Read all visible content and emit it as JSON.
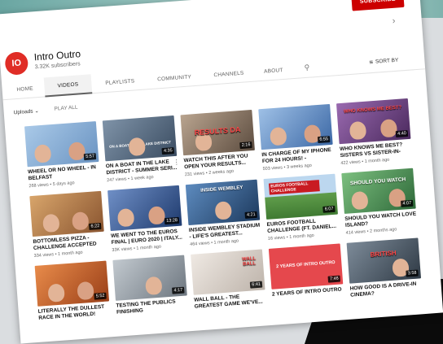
{
  "subscribe_label": "SUBSCRIBE",
  "channel": {
    "avatar_text": "IO",
    "name": "Intro Outro",
    "subscribers": "3.32K subscribers"
  },
  "tabs": [
    {
      "label": "HOME"
    },
    {
      "label": "VIDEOS"
    },
    {
      "label": "PLAYLISTS"
    },
    {
      "label": "COMMUNITY"
    },
    {
      "label": "CHANNELS"
    },
    {
      "label": "ABOUT"
    }
  ],
  "sort_by_label": "SORT BY",
  "filter": {
    "uploads_label": "Uploads",
    "play_all_label": "PLAY ALL"
  },
  "videos": [
    {
      "title": "WHEEL OR NO WHEEL - IN BELFAST",
      "meta": "268 views • 5 days ago",
      "duration": "5:57",
      "thumb_text": "",
      "thumb_color": "#8fb4d9"
    },
    {
      "title": "ON A BOAT IN THE LAKE DISTRICT - SUMMER SERI...",
      "meta": "247 views • 1 week ago",
      "duration": "4:35",
      "thumb_text": "ON A BOAT IN THE LAKE DISTRICT",
      "thumb_color": "#5a6f86"
    },
    {
      "title": "WATCH THIS AFTER YOU OPEN YOUR RESULTS...",
      "meta": "231 views • 2 weeks ago",
      "duration": "2:16",
      "thumb_text": "RESULTS DA",
      "thumb_color": "#7c6a5c"
    },
    {
      "title": "IN CHARGE OF MY IPHONE FOR 24 HOURS! - SUMMER...",
      "meta": "503 views • 3 weeks ago",
      "duration": "6:55",
      "thumb_text": "",
      "thumb_color": "#5f86b5"
    },
    {
      "title": "WHO KNOWS ME BEST? SISTERS vs SISTER-IN-LAW",
      "meta": "422 views • 1 month ago",
      "duration": "4:40",
      "thumb_text": "WHO KNOWS ME BEST?",
      "thumb_color": "#7b4b8e"
    },
    {
      "title": "BOTTOMLESS PIZZA - CHALLENGE ACCEPTED",
      "meta": "334 views • 1 month ago",
      "duration": "6:22",
      "thumb_text": "",
      "thumb_color": "#b9824c"
    },
    {
      "title": "WE WENT TO THE EUROS FINAL | EURO 2020 | ITALY...",
      "meta": "33K views • 1 month ago",
      "duration": "13:28",
      "thumb_text": "",
      "thumb_color": "#3d5f97"
    },
    {
      "title": "INSIDE WEMBLEY STADIUM - LIFE'S GREATEST...",
      "meta": "464 views • 1 month ago",
      "duration": "4:21",
      "thumb_text": "INSIDE WEMBLEY",
      "thumb_color": "#2f5f8f"
    },
    {
      "title": "EUROS FOOTBALL CHALLENGE (ft. Daniel...",
      "meta": "16 views • 1 month ago",
      "duration": "6:07",
      "thumb_text": "EUROS FOOTBALL CHALLENGE",
      "thumb_color": "#5f9c4a"
    },
    {
      "title": "SHOULD YOU WATCH LOVE ISLAND?",
      "meta": "414 views • 2 months ago",
      "duration": "4:07",
      "thumb_text": "SHOULD YOU WATCH",
      "thumb_color": "#4f8a59"
    },
    {
      "title": "LITERALLY THE DULLEST RACE IN THE WORLD!",
      "meta": "",
      "duration": "5:52",
      "thumb_text": "",
      "thumb_color": "#c7692c"
    },
    {
      "title": "TESTING THE PUBLICS FINISHING",
      "meta": "",
      "duration": "4:17",
      "thumb_text": "",
      "thumb_color": "#9aa3ab"
    },
    {
      "title": "WALL BALL - THE GREATEST GAME WE'VE...",
      "meta": "",
      "duration": "6:41",
      "thumb_text": "WALL BALL",
      "thumb_color": "#d9d2cc"
    },
    {
      "title": "2 YEARS OF INTRO OUTRO",
      "meta": "",
      "duration": "7:46",
      "thumb_text": "2 YEARS OF INTRO OUTRO",
      "thumb_color": "#e5484d"
    },
    {
      "title": "HOW GOOD IS A DRIVE-IN CINEMA?",
      "meta": "",
      "duration": "3:58",
      "thumb_text": "BRITISH",
      "thumb_color": "#4d5d6e"
    }
  ]
}
